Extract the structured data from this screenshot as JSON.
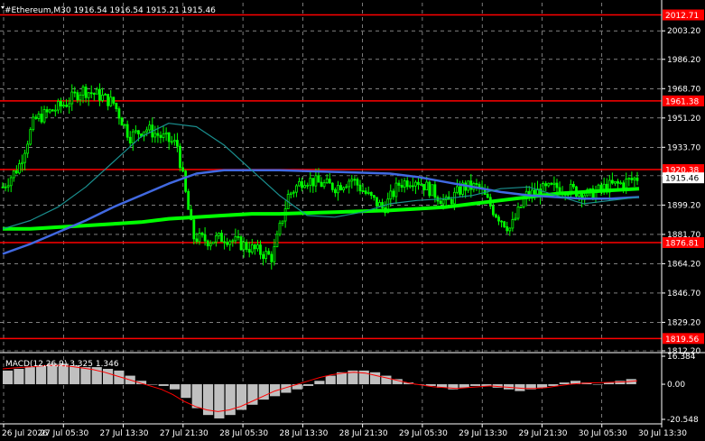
{
  "header": {
    "symbol_text": "#Ethereum,M30  1916.54 1916.54 1915.21 1915.46"
  },
  "chart_data": {
    "type": "candlestick",
    "instrument": "#Ethereum",
    "timeframe": "M30",
    "ohlc_header": {
      "open": 1916.54,
      "high": 1916.54,
      "low": 1915.21,
      "close": 1915.46
    },
    "current_price": 1915.46,
    "ylim": [
      1812.2,
      2020.0
    ],
    "y_ticks": [
      2003.2,
      1986.2,
      1968.7,
      1951.2,
      1933.7,
      1916.7,
      1899.2,
      1881.7,
      1864.2,
      1846.7,
      1829.2,
      1812.2
    ],
    "y_tick_labels": [
      "2003.20",
      "1986.20",
      "1968.70",
      "1951.20",
      "1933.70",
      "1916.70",
      "1899.20",
      "1881.70",
      "1864.20",
      "1846.70",
      "1829.20",
      "1812.20"
    ],
    "x_tick_labels": [
      "26 Jul 2026",
      "27 Jul 05:30",
      "27 Jul 13:30",
      "27 Jul 21:30",
      "28 Jul 05:30",
      "28 Jul 13:30",
      "28 Jul 21:30",
      "29 Jul 05:30",
      "29 Jul 13:30",
      "29 Jul 21:30",
      "30 Jul 05:30",
      "30 Jul 13:30"
    ],
    "horizontal_levels": [
      {
        "value": 2012.71,
        "label": "2012.71"
      },
      {
        "value": 1961.38,
        "label": "1961.38"
      },
      {
        "value": 1920.38,
        "label": "1920.38"
      },
      {
        "value": 1876.81,
        "label": "1876.81"
      },
      {
        "value": 1819.56,
        "label": "1819.56"
      }
    ],
    "moving_averages": [
      {
        "color": "#00ff00",
        "values": [
          1885,
          1885,
          1886,
          1887,
          1888,
          1889,
          1891,
          1892,
          1893,
          1894,
          1894,
          1894.5,
          1895,
          1895.5,
          1896,
          1897,
          1898,
          1900,
          1902,
          1904,
          1906,
          1907,
          1908,
          1909
        ]
      },
      {
        "color": "#4169e1",
        "values": [
          1870,
          1876,
          1883,
          1890,
          1898,
          1905,
          1912,
          1918,
          1920,
          1920,
          1920,
          1919.5,
          1919,
          1918.5,
          1918,
          1916,
          1913,
          1910,
          1907,
          1905,
          1904,
          1903,
          1903,
          1904
        ]
      },
      {
        "color": "#1a8f8f",
        "values": [
          1885,
          1890,
          1898,
          1910,
          1925,
          1940,
          1948,
          1946,
          1935,
          1920,
          1905,
          1893,
          1892,
          1895,
          1900,
          1902,
          1903,
          1905,
          1909,
          1910,
          1905,
          1900,
          1902,
          1904
        ]
      }
    ],
    "candles_close_path": [
      1910,
      1922,
      1950,
      1955,
      1960,
      1968,
      1965,
      1960,
      1940,
      1945,
      1940,
      1935,
      1880,
      1878,
      1880,
      1876,
      1872,
      1868,
      1905,
      1915,
      1912,
      1910,
      1915,
      1905,
      1897,
      1912,
      1915,
      1908,
      1900,
      1910,
      1910,
      1895,
      1885,
      1905,
      1908,
      1910,
      1908,
      1905,
      1910,
      1912,
      1915.46
    ],
    "macd": {
      "label": "MACD(12,26,9) 3.325 1.346",
      "ylim": [
        -20.548,
        16.384
      ],
      "y_tick_labels": [
        "16.384",
        "0.00",
        "-20.548"
      ],
      "histogram": [
        8,
        9,
        10,
        11,
        12,
        12,
        11,
        10,
        10,
        9,
        8,
        5,
        2,
        0,
        -1,
        -3,
        -8,
        -14,
        -18,
        -20,
        -18,
        -15,
        -12,
        -9,
        -7,
        -5,
        -3,
        -1,
        2,
        5,
        7,
        8,
        8,
        7,
        5,
        3,
        1,
        0,
        -1,
        -2,
        -3,
        -2,
        -1,
        -1,
        -2,
        -3,
        -4,
        -3,
        -2,
        -1,
        1,
        2,
        1,
        0,
        1,
        2,
        3
      ],
      "signal": [
        9,
        9.5,
        10,
        10.5,
        11,
        11,
        10.5,
        9.5,
        8.5,
        7,
        5,
        3,
        1,
        -1,
        -3,
        -6,
        -10,
        -13,
        -15,
        -16,
        -15,
        -13,
        -10,
        -7,
        -4,
        -2,
        0,
        2,
        4,
        5.5,
        6.5,
        7,
        6.5,
        5,
        3.5,
        2,
        0.5,
        -0.5,
        -1.5,
        -2,
        -2.5,
        -2,
        -1.5,
        -1,
        -1.5,
        -2,
        -2.5,
        -2.5,
        -2,
        -1,
        0,
        0.5,
        0.8,
        1,
        1.2,
        1.5,
        2
      ]
    }
  }
}
